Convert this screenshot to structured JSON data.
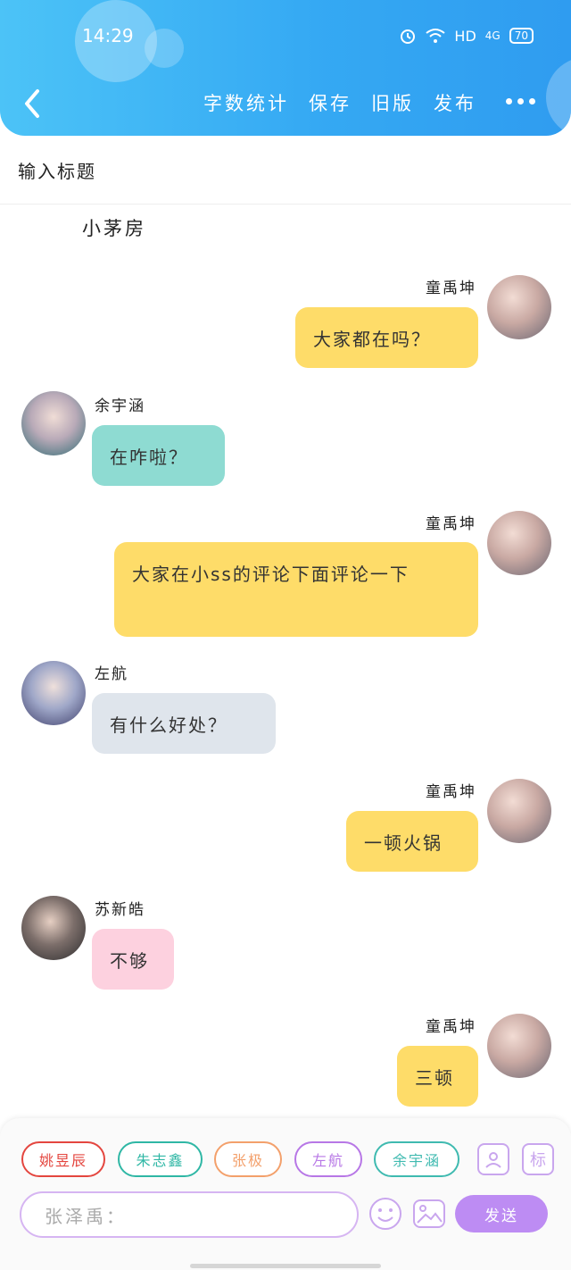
{
  "status": {
    "time": "14:29",
    "network": "HD",
    "signal": "4G",
    "battery": "70"
  },
  "header": {
    "toolbar": [
      "字数统计",
      "保存",
      "旧版",
      "发布"
    ]
  },
  "title_placeholder": "输入标题",
  "scene_text": "小茅房",
  "messages": [
    {
      "side": "right",
      "sender": "童禹坤",
      "text": "大家都在吗？",
      "color": "yellow"
    },
    {
      "side": "left",
      "sender": "余宇涵",
      "text": "在咋啦？",
      "color": "teal"
    },
    {
      "side": "right",
      "sender": "童禹坤",
      "text": "大家在小ss的评论下面评论一下",
      "color": "yellow"
    },
    {
      "side": "left",
      "sender": "左航",
      "text": "有什么好处？",
      "color": "gray"
    },
    {
      "side": "right",
      "sender": "童禹坤",
      "text": "一顿火锅",
      "color": "yellow"
    },
    {
      "side": "left",
      "sender": "苏新皓",
      "text": "不够",
      "color": "pink"
    },
    {
      "side": "right",
      "sender": "童禹坤",
      "text": "三顿",
      "color": "yellow"
    }
  ],
  "bottom": {
    "chips": [
      {
        "label": "姚昱辰",
        "color": "#e4463f"
      },
      {
        "label": "朱志鑫",
        "color": "#2fb7a5"
      },
      {
        "label": "张极",
        "color": "#f3a06b"
      },
      {
        "label": "左航",
        "color": "#b777e6"
      },
      {
        "label": "余宇涵",
        "color": "#3fbab0"
      }
    ],
    "tool_icons": [
      "person-card-icon",
      "标"
    ],
    "input_placeholder": "张泽禹：",
    "send_label": "发送"
  }
}
